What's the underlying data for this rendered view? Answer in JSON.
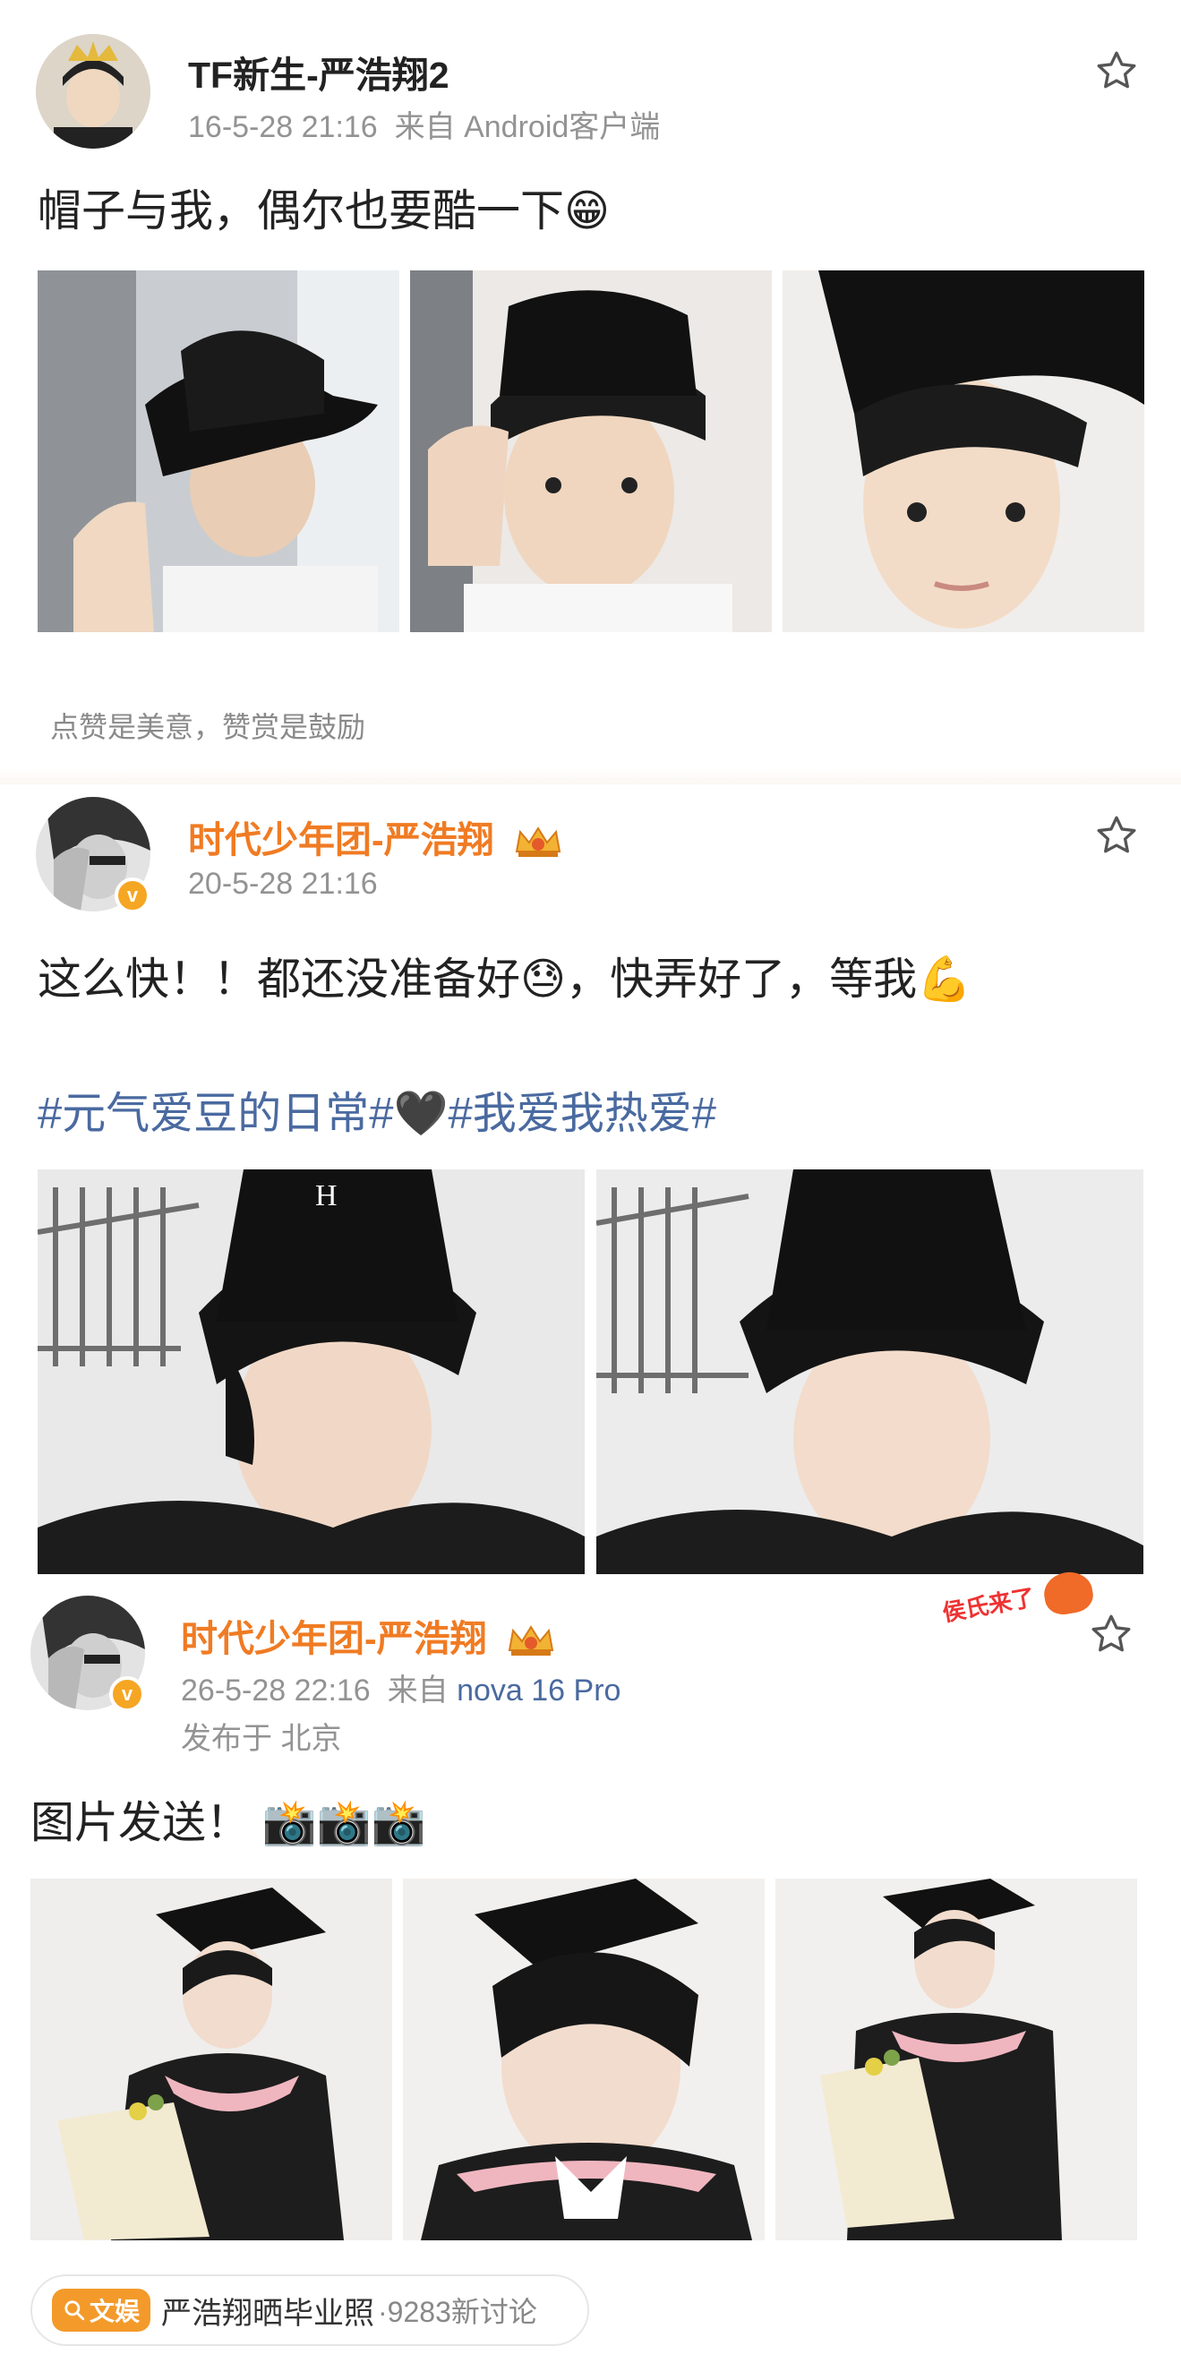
{
  "post1": {
    "name": "TF新生-严浩翔2",
    "time": "16-5-28 21:16",
    "source": "来自 Android客户端",
    "text": "帽子与我，偶尔也要酷一下",
    "emoji": "😁"
  },
  "hint": "点赞是美意，赞赏是鼓励",
  "post2": {
    "name": "时代少年团-严浩翔",
    "time": "20-5-28 21:16",
    "text_a": "这么快！！都还没准备好",
    "emoji_a": "😓",
    "text_b": "，快弄好了，等我",
    "emoji_b": "💪",
    "tag1": "#元气爱豆的日常#",
    "heart": "🖤",
    "tag2": "#我爱我热爱#"
  },
  "post3": {
    "name": "时代少年团-严浩翔",
    "time": "26-5-28 22:16",
    "source_prefix": "来自",
    "device": "nova 16 Pro",
    "location": "发布于 北京",
    "text": "图片发送！",
    "emojis": "📸📸📸",
    "sticker": "侯氏来了"
  },
  "topic": {
    "badge": "文娱",
    "text": "严浩翔晒毕业照",
    "count": "·9283新讨论"
  },
  "colors": {
    "orange": "#f07b23",
    "link": "#4a6aa0",
    "gray": "#939393"
  },
  "icons": [
    "star-icon",
    "verified-icon",
    "crown-icon",
    "search-icon"
  ]
}
